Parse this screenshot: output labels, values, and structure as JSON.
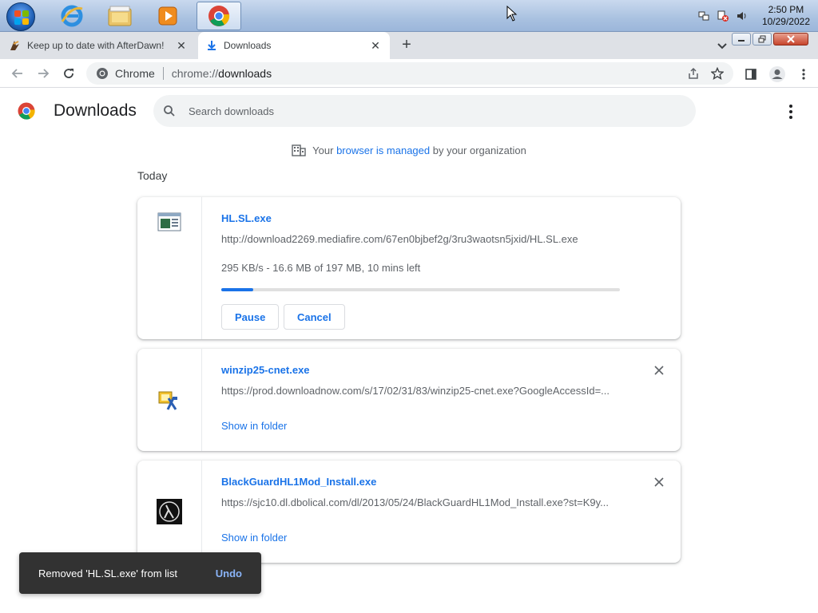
{
  "taskbar": {
    "apps": [
      {
        "name": "internet-explorer",
        "icon": "ie-icon"
      },
      {
        "name": "file-explorer",
        "icon": "folder-icon"
      },
      {
        "name": "media-player",
        "icon": "media-player-icon"
      },
      {
        "name": "chrome",
        "icon": "chrome-icon",
        "active": true
      }
    ],
    "clock": {
      "time": "2:50 PM",
      "date": "10/29/2022"
    }
  },
  "tabs": [
    {
      "title": "Keep up to date with AfterDawn!",
      "icon": "afterdawn-icon",
      "active": false
    },
    {
      "title": "Downloads",
      "icon": "download-icon",
      "active": true
    }
  ],
  "omnibox": {
    "site_label": "Chrome",
    "url_scheme": "chrome://",
    "url_host": "downloads"
  },
  "page": {
    "title": "Downloads",
    "search_placeholder": "Search downloads",
    "managed_prefix": "Your ",
    "managed_link": "browser is managed",
    "managed_suffix": " by your organization",
    "section_date": "Today"
  },
  "downloads": [
    {
      "filename": "HL.SL.exe",
      "url": "http://download2269.mediafire.com/67en0bjbef2g/3ru3waotsn5jxid/HL.SL.exe",
      "status": "295 KB/s - 16.6 MB of 197 MB, 10 mins left",
      "progress": 0.08,
      "pause_label": "Pause",
      "cancel_label": "Cancel"
    },
    {
      "filename": "winzip25-cnet.exe",
      "url": "https://prod.downloadnow.com/s/17/02/31/83/winzip25-cnet.exe?GoogleAccessId=...",
      "action_label": "Show in folder"
    },
    {
      "filename": "BlackGuardHL1Mod_Install.exe",
      "url": "https://sjc10.dl.dbolical.com/dl/2013/05/24/BlackGuardHL1Mod_Install.exe?st=K9y...",
      "action_label": "Show in folder"
    }
  ],
  "toast": {
    "message": "Removed 'HL.SL.exe' from list",
    "undo_label": "Undo"
  },
  "colors": {
    "accent": "#1a73e8",
    "toast_bg": "#323232",
    "toast_action": "#8ab4f8"
  }
}
